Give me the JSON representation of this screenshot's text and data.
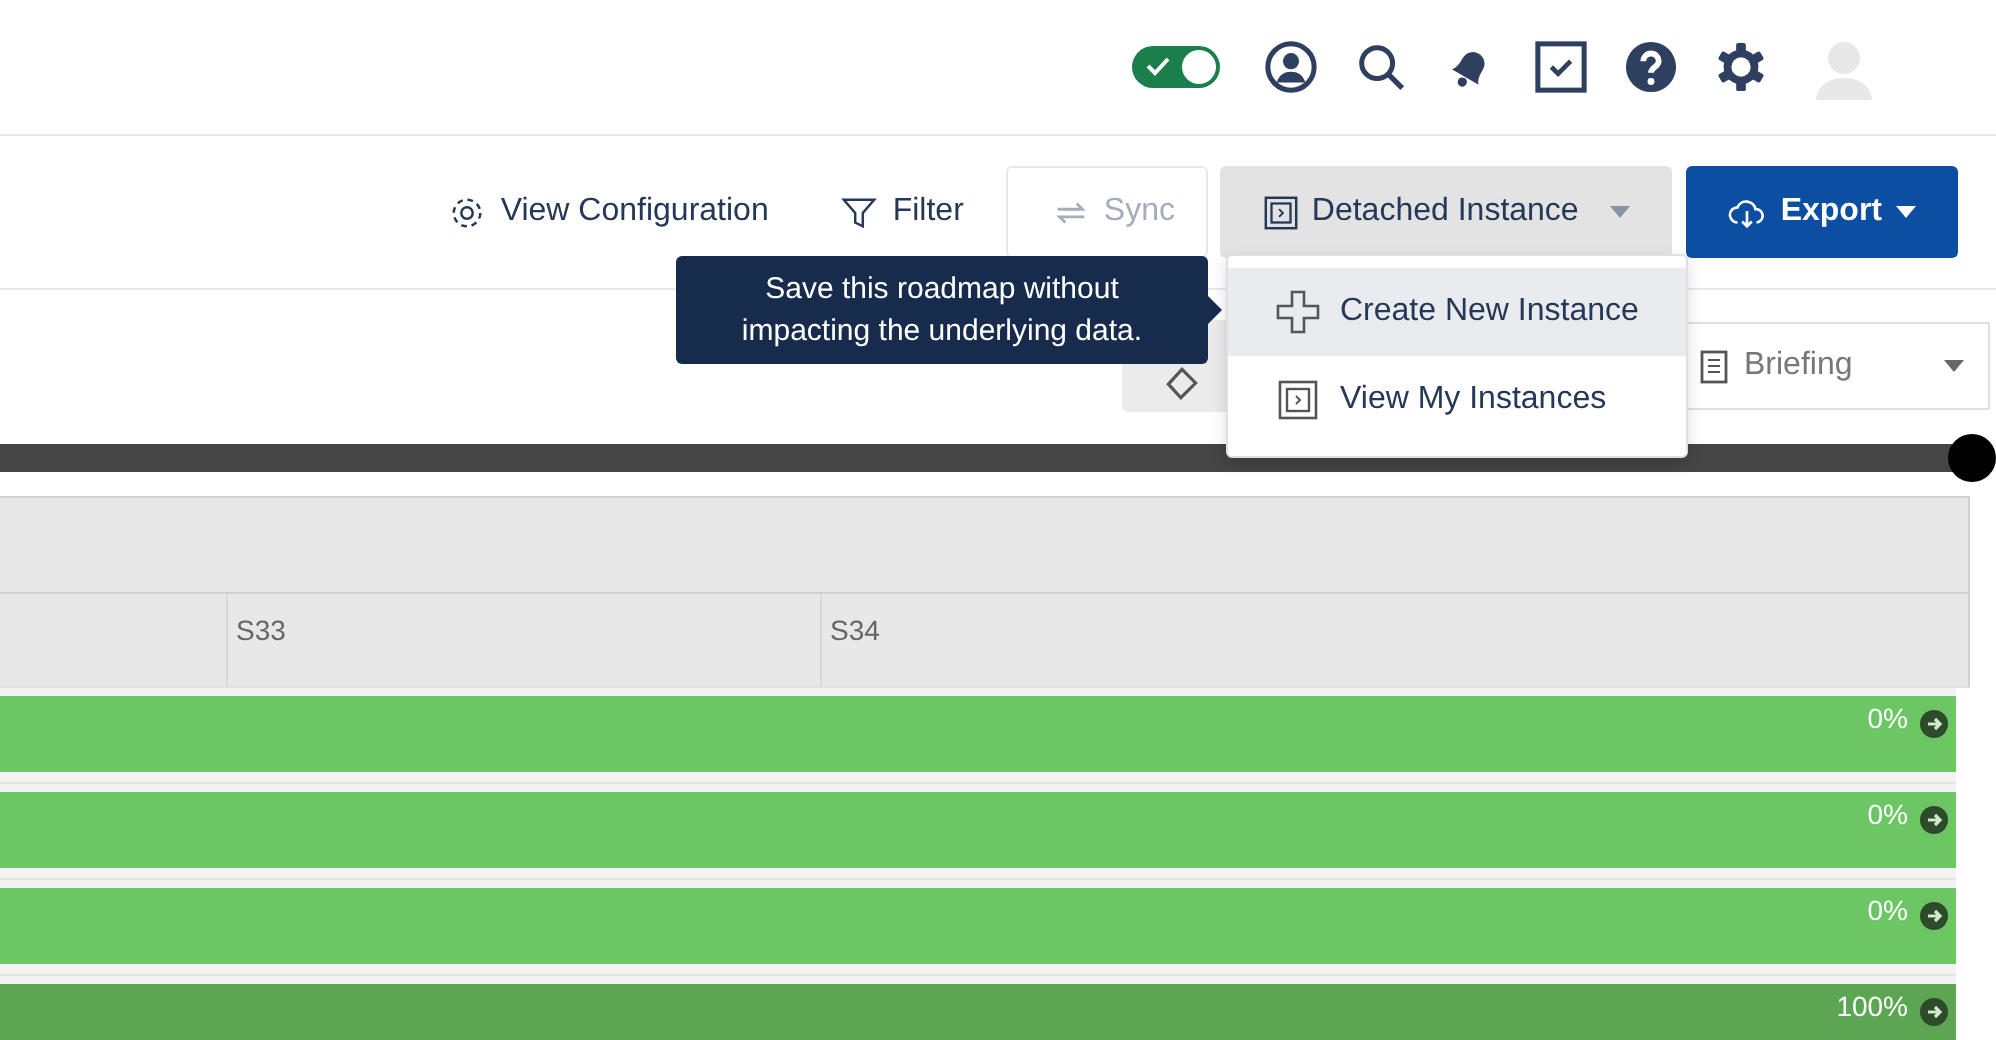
{
  "header": {
    "toggle": {
      "on": true
    }
  },
  "toolbar": {
    "buttons": [
      {
        "kind": "config",
        "label": "View Configuration",
        "disabled": false
      },
      {
        "kind": "filter",
        "label": "Filter",
        "disabled": false
      },
      {
        "kind": "sync",
        "label": "Sync",
        "disabled": true
      },
      {
        "kind": "instance",
        "label": "Detached Instance",
        "disabled": false
      },
      {
        "kind": "export",
        "label": "Export",
        "disabled": false
      }
    ]
  },
  "tooltip": {
    "text": "Save this roadmap without impacting the underlying data."
  },
  "dropdown_menu": {
    "items": [
      {
        "kind": "create",
        "label": "Create New Instance",
        "selected": true
      },
      {
        "kind": "view",
        "label": "View My Instances",
        "selected": false
      }
    ]
  },
  "subbar": {
    "view_select": {
      "value": "Briefing"
    }
  },
  "timeline": {
    "columns": [
      "S33",
      "S34"
    ],
    "bars": [
      {
        "progress": "0%",
        "color": "#6dc664"
      },
      {
        "progress": "0%",
        "color": "#6dc664"
      },
      {
        "progress": "0%",
        "color": "#6dc664"
      },
      {
        "progress": "100%",
        "color": "#5ca653"
      }
    ]
  }
}
